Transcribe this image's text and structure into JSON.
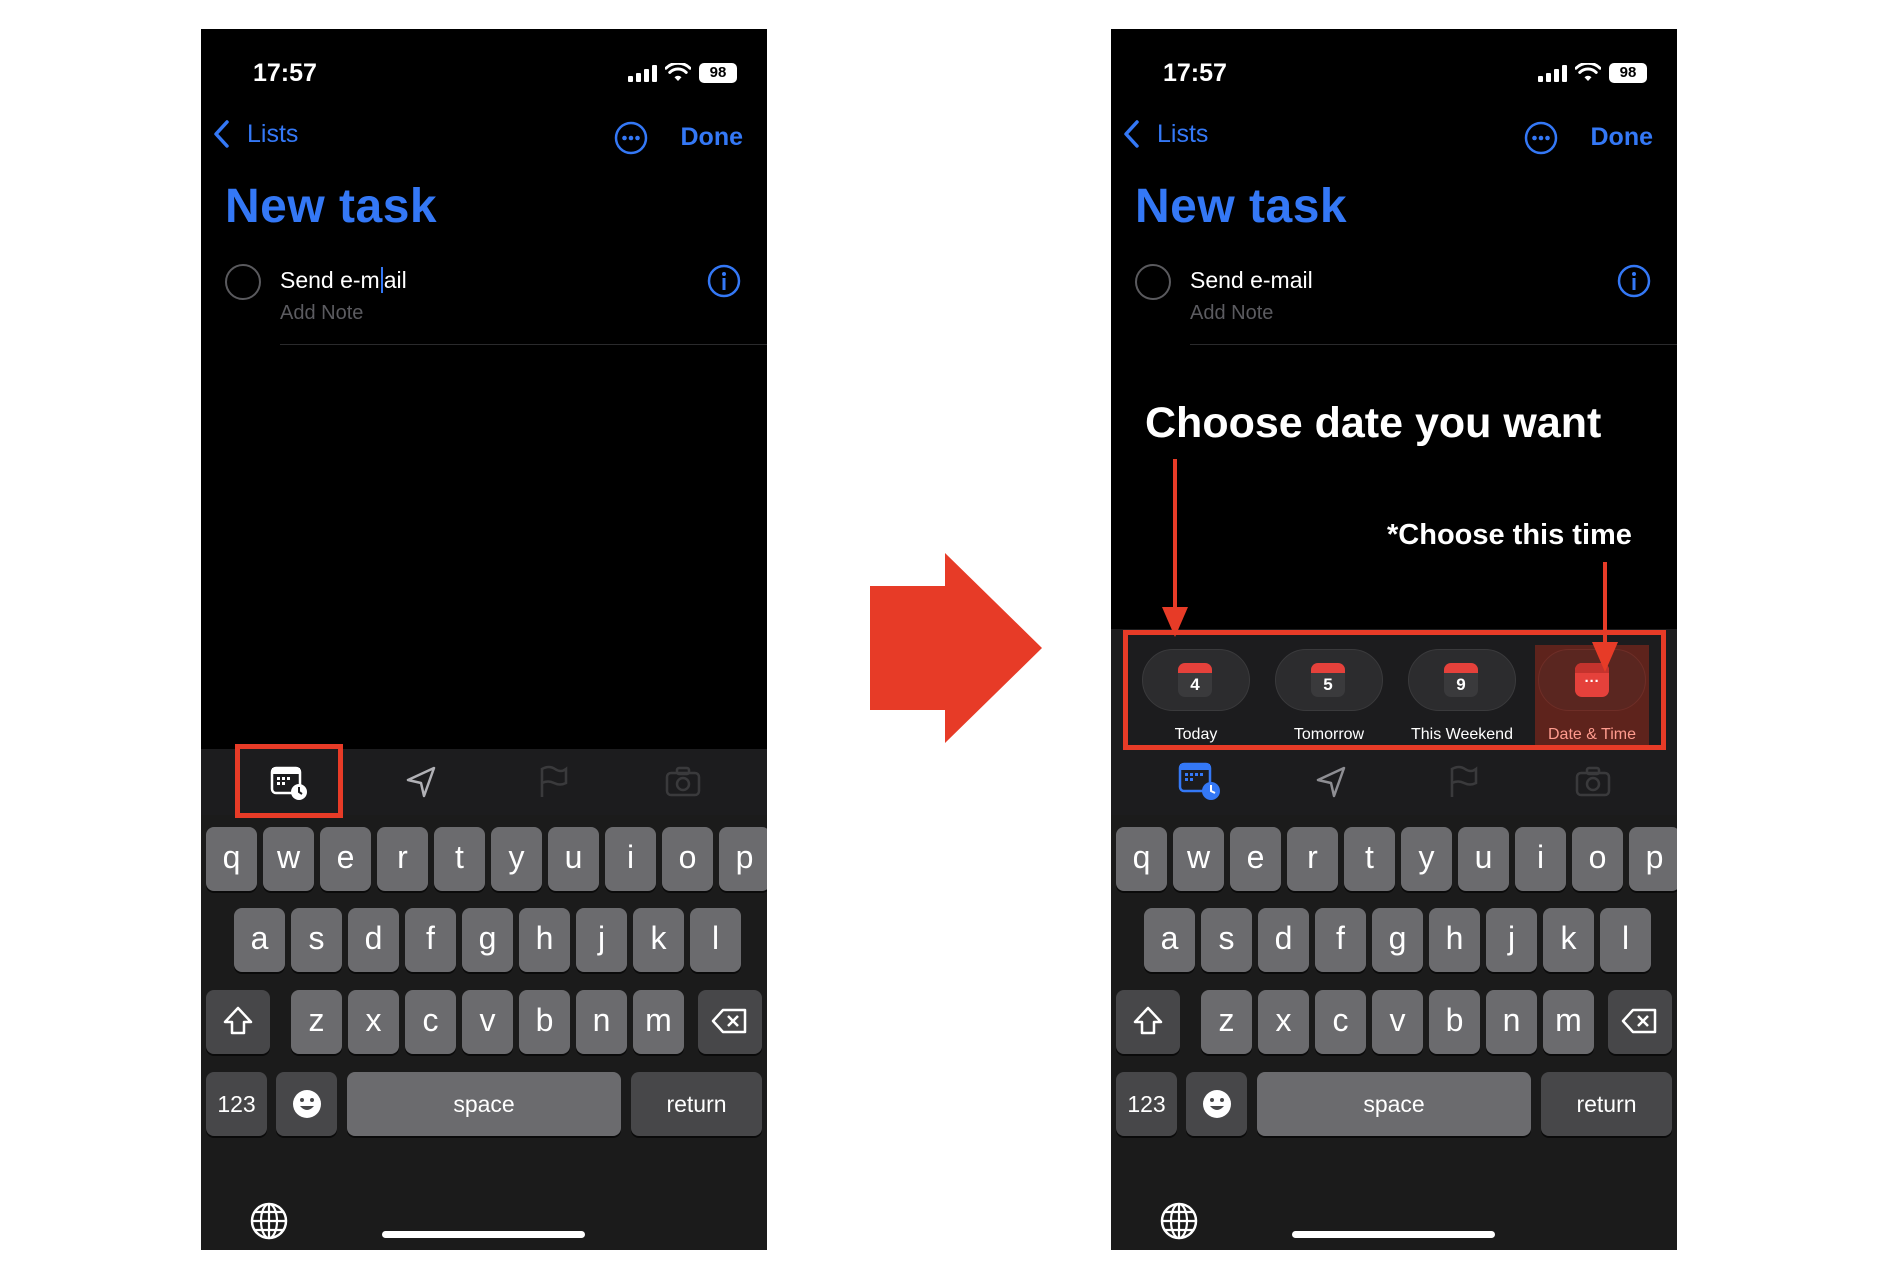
{
  "status": {
    "time": "17:57",
    "battery": "98"
  },
  "nav": {
    "back_label": "Lists",
    "done_label": "Done"
  },
  "title": "New task",
  "task": {
    "name_before_cursor": "Send e-m",
    "name_after_cursor": "ail",
    "name": "Send e-mail",
    "note_placeholder": "Add Note"
  },
  "date_options": [
    {
      "label": "Today",
      "day": "4"
    },
    {
      "label": "Tomorrow",
      "day": "5"
    },
    {
      "label": "This Weekend",
      "day": "9"
    },
    {
      "label": "Date & Time",
      "day": "···"
    }
  ],
  "keyboard": {
    "row1": [
      "q",
      "w",
      "e",
      "r",
      "t",
      "y",
      "u",
      "i",
      "o",
      "p"
    ],
    "row2": [
      "a",
      "s",
      "d",
      "f",
      "g",
      "h",
      "j",
      "k",
      "l"
    ],
    "row3": [
      "z",
      "x",
      "c",
      "v",
      "b",
      "n",
      "m"
    ],
    "numbers_label": "123",
    "space_label": "space",
    "return_label": "return"
  },
  "annotations": {
    "headline": "Choose date you want",
    "hint": "*Choose this time"
  },
  "colors": {
    "accent": "#3478f6",
    "annotation": "#e73b27",
    "calendar_red": "#e5413b"
  },
  "icons": [
    "chevron-left-icon",
    "ellipsis-circle-icon",
    "info-icon",
    "calendar-clock-icon",
    "location-arrow-icon",
    "flag-icon",
    "camera-icon",
    "shift-icon",
    "delete-icon",
    "emoji-icon",
    "globe-icon"
  ]
}
